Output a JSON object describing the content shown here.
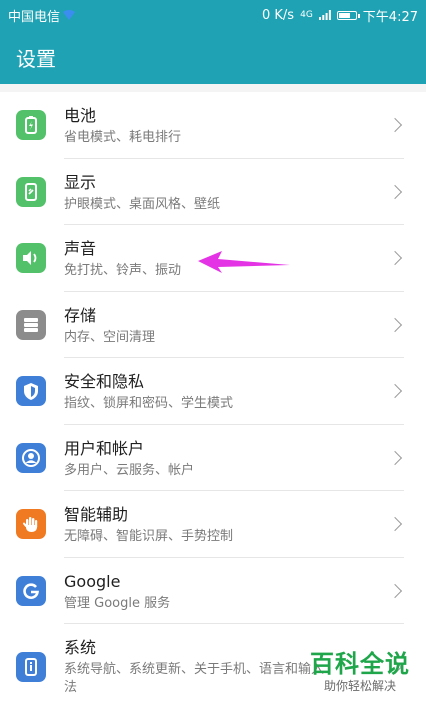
{
  "status_bar": {
    "carrier": "中国电信",
    "speed": "0 K/s",
    "network": "4G",
    "time": "下午4:27"
  },
  "app_bar": {
    "title": "设置"
  },
  "colors": {
    "header": "#1fa2b3",
    "battery_icon_bg": "#53c169",
    "display_icon_bg": "#53c169",
    "sound_icon_bg": "#53c169",
    "storage_icon_bg": "#8c8c8c",
    "security_icon_bg": "#3f7fd8",
    "users_icon_bg": "#3f7fd8",
    "assist_icon_bg": "#f07a22",
    "google_icon_bg": "#3f7fd8",
    "system_icon_bg": "#3f7fd8",
    "annotation_arrow": "#e433e4",
    "watermark_green": "#1fa64a"
  },
  "settings": [
    {
      "title": "电池",
      "subtitle": "省电模式、耗电排行",
      "icon": "battery-icon"
    },
    {
      "title": "显示",
      "subtitle": "护眼模式、桌面风格、壁纸",
      "icon": "display-icon"
    },
    {
      "title": "声音",
      "subtitle": "免打扰、铃声、振动",
      "icon": "speaker-icon"
    },
    {
      "title": "存储",
      "subtitle": "内存、空间清理",
      "icon": "storage-icon"
    },
    {
      "title": "安全和隐私",
      "subtitle": "指纹、锁屏和密码、学生模式",
      "icon": "shield-icon"
    },
    {
      "title": "用户和帐户",
      "subtitle": "多用户、云服务、帐户",
      "icon": "user-icon"
    },
    {
      "title": "智能辅助",
      "subtitle": "无障碍、智能识屏、手势控制",
      "icon": "hand-icon"
    },
    {
      "title": "Google",
      "subtitle": "管理 Google 服务",
      "icon": "google-icon"
    },
    {
      "title": "系统",
      "subtitle": "系统导航、系统更新、关于手机、语言和输入法",
      "icon": "system-icon"
    }
  ],
  "watermark": {
    "title": "百科全说",
    "subtitle": "助你轻松解决"
  }
}
